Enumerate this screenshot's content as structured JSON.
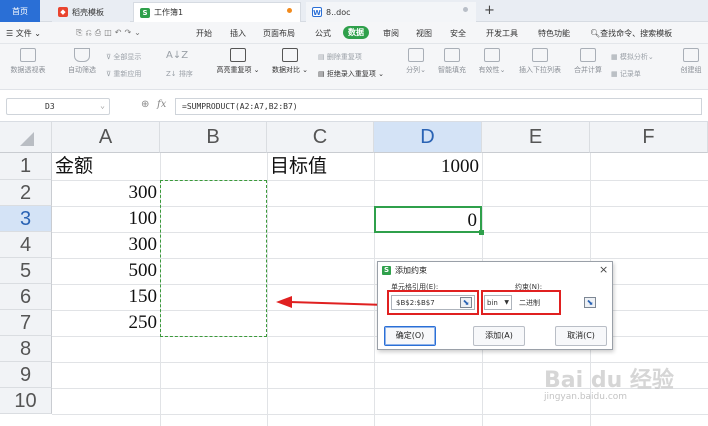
{
  "tabs": {
    "home": "首页",
    "template": "稻壳模板",
    "sheet": "工作簿1",
    "doc": "8..doc"
  },
  "menu": {
    "file": "文件",
    "items": [
      "开始",
      "插入",
      "页面布局",
      "公式",
      "数据",
      "审阅",
      "视图",
      "安全",
      "开发工具",
      "特色功能"
    ],
    "active": "数据",
    "search": "查找命令、搜索模板"
  },
  "ribbon": {
    "pivot": "数据透视表",
    "autofilter": "自动筛选",
    "show_all": "全部显示",
    "reapply": "重新应用",
    "sort": "排序",
    "highlight_dup": "高亮重复项",
    "compare": "数据对比",
    "remove_dup": "删除重复项",
    "reject_dup": "拒绝录入重复项",
    "split": "分列",
    "fill": "智能填充",
    "validity": "有效性",
    "dropdown": "插入下拉列表",
    "consolidate": "合并计算",
    "whatif": "模拟分析",
    "record": "记录单",
    "create": "创建组"
  },
  "formula_bar": {
    "cell_ref": "D3",
    "fx": "fx",
    "formula": "=SUMPRODUCT(A2:A7,B2:B7)"
  },
  "grid": {
    "columns": [
      "A",
      "B",
      "C",
      "D",
      "E",
      "F"
    ],
    "selected_column": "D",
    "rows": [
      "1",
      "2",
      "3",
      "4",
      "5",
      "6",
      "7",
      "8",
      "9",
      "10"
    ],
    "selected_row": "3",
    "cells": {
      "A1": "金额",
      "C1": "目标值",
      "D1": "1000",
      "A2": "300",
      "A3": "100",
      "A4": "300",
      "A5": "500",
      "A6": "150",
      "A7": "250",
      "D3": "0"
    }
  },
  "dialog": {
    "title": "添加约束",
    "cell_ref_label": "单元格引用(E):",
    "constraint_label": "约束(N):",
    "cell_ref_value": "$B$2:$B$7",
    "operator": "bin",
    "constraint_value": "二进制",
    "ok": "确定(O)",
    "add": "添加(A)",
    "cancel": "取消(C)",
    "close": "×"
  },
  "colors": {
    "accent_blue": "#2a6fd6",
    "data_green": "#2fa04b",
    "highlight_red": "#e02020"
  },
  "watermark": {
    "brand": "Bai du 经验",
    "url": "jingyan.baidu.com"
  }
}
